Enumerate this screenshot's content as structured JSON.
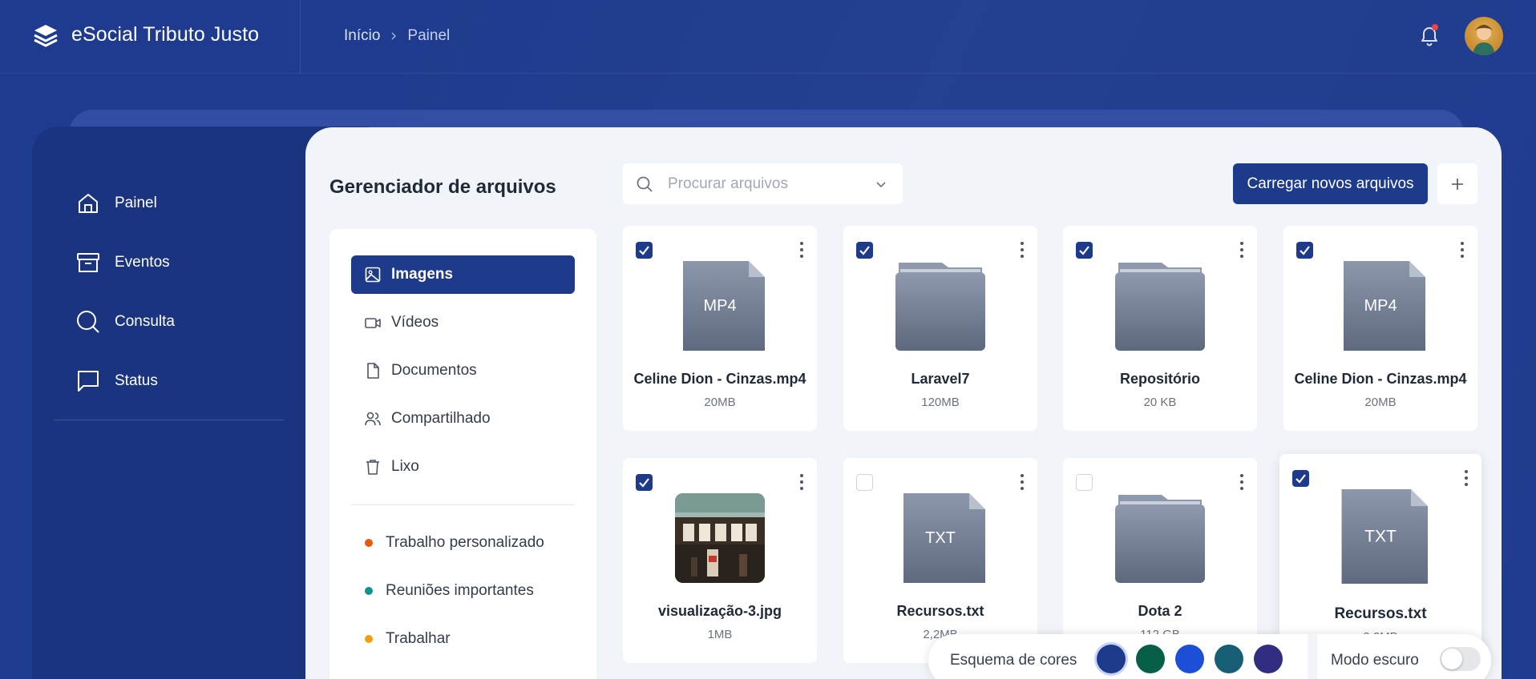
{
  "app": {
    "title": "eSocial Tributo Justo"
  },
  "breadcrumb": {
    "home": "Início",
    "current": "Painel"
  },
  "sidebar": {
    "items": [
      {
        "label": "Painel",
        "icon": "home-icon"
      },
      {
        "label": "Eventos",
        "icon": "archive-icon"
      },
      {
        "label": "Consulta",
        "icon": "search-icon"
      },
      {
        "label": "Status",
        "icon": "message-square-icon"
      }
    ]
  },
  "file_manager": {
    "title": "Gerenciador de arquivos",
    "search_placeholder": "Procurar arquivos",
    "upload_label": "Carregar novos arquivos",
    "filters": [
      {
        "label": "Imagens",
        "icon": "image-icon",
        "active": true
      },
      {
        "label": "Vídeos",
        "icon": "video-icon",
        "active": false
      },
      {
        "label": "Documentos",
        "icon": "file-icon",
        "active": false
      },
      {
        "label": "Compartilhado",
        "icon": "users-icon",
        "active": false
      },
      {
        "label": "Lixo",
        "icon": "trash-icon",
        "active": false
      }
    ],
    "tags": [
      {
        "label": "Trabalho personalizado",
        "color": "#ea580c"
      },
      {
        "label": "Reuniões importantes",
        "color": "#0d9488"
      },
      {
        "label": "Trabalhar",
        "color": "#f59e0b"
      }
    ],
    "files": [
      {
        "name": "Celine Dion - Cinzas.mp4",
        "size": "20MB",
        "type": "MP4",
        "kind": "file",
        "checked": true
      },
      {
        "name": "Laravel7",
        "size": "120MB",
        "kind": "folder",
        "checked": true
      },
      {
        "name": "Repositório",
        "size": "20 KB",
        "kind": "folder",
        "checked": true
      },
      {
        "name": "Celine Dion - Cinzas.mp4",
        "size": "20MB",
        "type": "MP4",
        "kind": "file",
        "checked": true
      },
      {
        "name": "visualização-3.jpg",
        "size": "1MB",
        "kind": "image",
        "checked": true
      },
      {
        "name": "Recursos.txt",
        "size": "2,2MB",
        "type": "TXT",
        "kind": "file",
        "checked": false
      },
      {
        "name": "Dota 2",
        "size": "112 GB",
        "kind": "folder",
        "checked": false
      },
      {
        "name": "Recursos.txt",
        "size": "2,2MB",
        "type": "TXT",
        "kind": "file",
        "checked": true
      }
    ]
  },
  "color_scheme": {
    "label": "Esquema de cores",
    "swatches": [
      "#1e3a8a",
      "#065f46",
      "#1d4ed8",
      "#155e75",
      "#312e81"
    ],
    "selected": 0,
    "dark_mode_label": "Modo escuro",
    "dark_mode": false
  }
}
